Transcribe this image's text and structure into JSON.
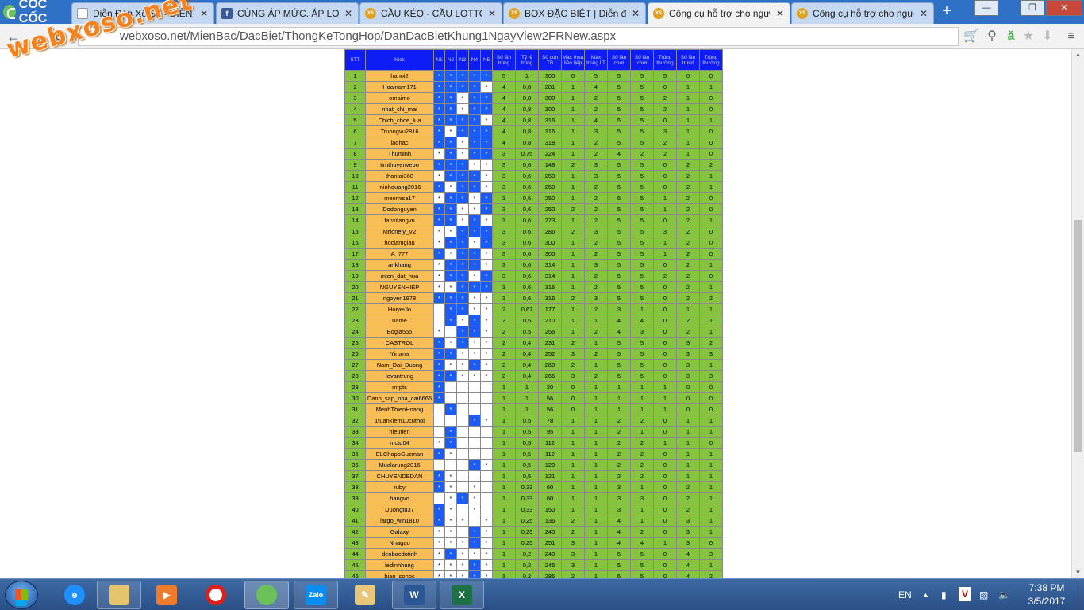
{
  "browser": {
    "logo_text": "CỐC CỐC",
    "tabs": [
      {
        "title": "Diễn Đàn Xổ Số - DIỄN ĐÀN",
        "favicon": "doc",
        "active": false
      },
      {
        "title": "CÙNG ÁP MỨC. ÁP LOẠI",
        "favicon": "fb",
        "active": false
      },
      {
        "title": "CẦU KÉO - CẦU LOTTO, I",
        "favicon": "xs",
        "active": false
      },
      {
        "title": "BOX ĐẶC BIỆT | Diễn đàn",
        "favicon": "xs",
        "active": false
      },
      {
        "title": "Công cụ hỗ trợ cho người",
        "favicon": "xs",
        "active": true
      },
      {
        "title": "Công cụ hỗ trợ cho người",
        "favicon": "xs",
        "active": false
      }
    ],
    "tab_favicon_xs": "XS",
    "tab_favicon_fb": "f",
    "address": "webxoso.net/MienBac/DacBiet/ThongKeTongHop/DanDacBietKhung1NgayView2FRNew.aspx",
    "watermark": "webxoso.net"
  },
  "table": {
    "headers": [
      "STT",
      "Nick",
      "N1",
      "N2",
      "N3",
      "N4",
      "N5",
      "Số lần trúng",
      "Tỷ lệ trúng",
      "Số con TB",
      "Max thua liên tiếp",
      "Max trúng LT",
      "Số lần chơi",
      "Số lần chơi",
      "Trúng thưởng",
      "Số lần trượt",
      "Trúng thưởng"
    ],
    "rows": [
      {
        "n": "hanoi2",
        "m": "bbbbb",
        "v": [
          "5",
          "1",
          "300",
          "0",
          "5",
          "5",
          "5",
          "5",
          "0",
          "0"
        ]
      },
      {
        "n": "Hoainam171",
        "m": "bbbbw",
        "v": [
          "4",
          "0,8",
          "281",
          "1",
          "4",
          "5",
          "5",
          "0",
          "1",
          "1"
        ]
      },
      {
        "n": "omaimo",
        "m": "bbwbb",
        "v": [
          "4",
          "0,8",
          "300",
          "1",
          "2",
          "5",
          "5",
          "2",
          "1",
          "0"
        ]
      },
      {
        "n": "nhat_chi_mai",
        "m": "bbwbb",
        "v": [
          "4",
          "0,8",
          "300",
          "1",
          "2",
          "5",
          "5",
          "2",
          "1",
          "0"
        ]
      },
      {
        "n": "Chich_choe_lua",
        "m": "bbbbw",
        "v": [
          "4",
          "0,8",
          "316",
          "1",
          "4",
          "5",
          "5",
          "0",
          "1",
          "1"
        ]
      },
      {
        "n": "Truongvu2816",
        "m": "bwbbb",
        "v": [
          "4",
          "0,8",
          "316",
          "1",
          "3",
          "5",
          "5",
          "3",
          "1",
          "0"
        ]
      },
      {
        "n": "laohac",
        "m": "bbwbb",
        "v": [
          "4",
          "0,8",
          "318",
          "1",
          "2",
          "5",
          "5",
          "2",
          "1",
          "0"
        ]
      },
      {
        "n": "Thuminh",
        "m": "wbwbb",
        "v": [
          "3",
          "0,75",
          "224",
          "1",
          "2",
          "4",
          "2",
          "2",
          "1",
          "0"
        ]
      },
      {
        "n": "timthuyenvebo",
        "m": "bbbww",
        "v": [
          "3",
          "0,6",
          "148",
          "2",
          "3",
          "5",
          "5",
          "0",
          "2",
          "2"
        ]
      },
      {
        "n": "thantai368",
        "m": "wbbbw",
        "v": [
          "3",
          "0,6",
          "250",
          "1",
          "3",
          "5",
          "5",
          "0",
          "2",
          "1"
        ]
      },
      {
        "n": "minhquang2016",
        "m": "bwbbw",
        "v": [
          "3",
          "0,6",
          "250",
          "1",
          "2",
          "5",
          "5",
          "0",
          "2",
          "1"
        ]
      },
      {
        "n": "meomisa17",
        "m": "wbbwb",
        "v": [
          "3",
          "0,6",
          "250",
          "1",
          "2",
          "5",
          "5",
          "1",
          "2",
          "0"
        ]
      },
      {
        "n": "Dodonguyen",
        "m": "bbwwb",
        "v": [
          "3",
          "0,6",
          "250",
          "2",
          "2",
          "5",
          "5",
          "1",
          "2",
          "0"
        ]
      },
      {
        "n": "fanxifangvn",
        "m": "bbwbw",
        "v": [
          "3",
          "0,6",
          "273",
          "1",
          "2",
          "5",
          "5",
          "0",
          "2",
          "1"
        ]
      },
      {
        "n": "Mrlonely_V2",
        "m": "wwbbb",
        "v": [
          "3",
          "0,6",
          "286",
          "2",
          "3",
          "5",
          "5",
          "3",
          "2",
          "0"
        ]
      },
      {
        "n": "hoclamgiau",
        "m": "wbbwb",
        "v": [
          "3",
          "0,6",
          "300",
          "1",
          "2",
          "5",
          "5",
          "1",
          "2",
          "0"
        ]
      },
      {
        "n": "A_777",
        "m": "bwbbw",
        "v": [
          "3",
          "0,6",
          "300",
          "1",
          "2",
          "5",
          "5",
          "1",
          "2",
          "0"
        ]
      },
      {
        "n": "ankhang",
        "m": "wbbbw",
        "v": [
          "3",
          "0,6",
          "314",
          "1",
          "3",
          "5",
          "5",
          "0",
          "2",
          "1"
        ]
      },
      {
        "n": "mien_dat_hua",
        "m": "wbbwb",
        "v": [
          "3",
          "0,6",
          "314",
          "1",
          "2",
          "5",
          "5",
          "2",
          "2",
          "0"
        ]
      },
      {
        "n": "NGUYENHIEP",
        "m": "wwbbb",
        "v": [
          "3",
          "0,6",
          "316",
          "1",
          "2",
          "5",
          "5",
          "0",
          "2",
          "1"
        ]
      },
      {
        "n": "ngoyen1978",
        "m": "bbbww",
        "v": [
          "3",
          "0,6",
          "316",
          "2",
          "3",
          "5",
          "5",
          "0",
          "2",
          "2"
        ]
      },
      {
        "n": "Hoiyeulo",
        "m": "ebbww",
        "v": [
          "2",
          "0,67",
          "177",
          "1",
          "2",
          "3",
          "1",
          "0",
          "1",
          "1"
        ]
      },
      {
        "n": "name",
        "m": "ebwbw",
        "v": [
          "2",
          "0,5",
          "210",
          "1",
          "1",
          "4",
          "4",
          "0",
          "2",
          "1"
        ]
      },
      {
        "n": "Bogia555",
        "m": "webbw",
        "v": [
          "2",
          "0,5",
          "256",
          "1",
          "2",
          "4",
          "3",
          "0",
          "2",
          "1"
        ]
      },
      {
        "n": "CASTROL",
        "m": "bwbww",
        "v": [
          "2",
          "0,4",
          "231",
          "2",
          "1",
          "5",
          "5",
          "0",
          "3",
          "2"
        ]
      },
      {
        "n": "Yiruma",
        "m": "bbwww",
        "v": [
          "2",
          "0,4",
          "252",
          "3",
          "2",
          "5",
          "5",
          "0",
          "3",
          "3"
        ]
      },
      {
        "n": "Nam_Dai_Duong",
        "m": "bwwbw",
        "v": [
          "2",
          "0,4",
          "260",
          "2",
          "1",
          "5",
          "5",
          "0",
          "3",
          "1"
        ]
      },
      {
        "n": "levantrung",
        "m": "bbwww",
        "v": [
          "2",
          "0,4",
          "266",
          "3",
          "2",
          "5",
          "5",
          "0",
          "3",
          "3"
        ]
      },
      {
        "n": "mrpts",
        "m": "beeee",
        "v": [
          "1",
          "1",
          "20",
          "0",
          "1",
          "1",
          "1",
          "1",
          "0",
          "0"
        ]
      },
      {
        "n": "Danh_sap_nha_cai6666",
        "m": "beeee",
        "v": [
          "1",
          "1",
          "56",
          "0",
          "1",
          "1",
          "1",
          "1",
          "0",
          "0"
        ]
      },
      {
        "n": "MenhThienHoang",
        "m": "ebeee",
        "v": [
          "1",
          "1",
          "56",
          "0",
          "1",
          "1",
          "1",
          "1",
          "0",
          "0"
        ]
      },
      {
        "n": "1tuankiem10cuthoi",
        "m": "eeebw",
        "v": [
          "1",
          "0,5",
          "78",
          "1",
          "1",
          "2",
          "2",
          "0",
          "1",
          "1"
        ]
      },
      {
        "n": "hieutien",
        "m": "ebeee",
        "v": [
          "1",
          "0,5",
          "95",
          "1",
          "1",
          "2",
          "1",
          "0",
          "1",
          "1"
        ]
      },
      {
        "n": "mctq04",
        "m": "wbeee",
        "v": [
          "1",
          "0,5",
          "112",
          "1",
          "1",
          "2",
          "2",
          "1",
          "1",
          "0"
        ]
      },
      {
        "n": "ELChapoGuzman",
        "m": "bweee",
        "v": [
          "1",
          "0,5",
          "112",
          "1",
          "1",
          "2",
          "2",
          "0",
          "1",
          "1"
        ]
      },
      {
        "n": "Mualarung2016",
        "m": "eeebw",
        "v": [
          "1",
          "0,5",
          "120",
          "1",
          "1",
          "2",
          "2",
          "0",
          "1",
          "1"
        ]
      },
      {
        "n": "CHUYENDEDAN",
        "m": "bweee",
        "v": [
          "1",
          "0,5",
          "121",
          "1",
          "1",
          "2",
          "2",
          "0",
          "1",
          "1"
        ]
      },
      {
        "n": "ruby",
        "m": "bwewe",
        "v": [
          "1",
          "0,33",
          "60",
          "1",
          "1",
          "3",
          "1",
          "0",
          "2",
          "1"
        ]
      },
      {
        "n": "hangvo",
        "m": "ewbwe",
        "v": [
          "1",
          "0,33",
          "60",
          "1",
          "1",
          "3",
          "3",
          "0",
          "2",
          "1"
        ]
      },
      {
        "n": "Duongtu37",
        "m": "bwewe",
        "v": [
          "1",
          "0,33",
          "150",
          "1",
          "1",
          "3",
          "1",
          "0",
          "2",
          "1"
        ]
      },
      {
        "n": "largo_win1810",
        "m": "bwwew",
        "v": [
          "1",
          "0,25",
          "136",
          "2",
          "1",
          "4",
          "1",
          "0",
          "3",
          "1"
        ]
      },
      {
        "n": "Galaxy",
        "m": "wwebw",
        "v": [
          "1",
          "0,25",
          "240",
          "2",
          "1",
          "4",
          "2",
          "0",
          "3",
          "1"
        ]
      },
      {
        "n": "Nhagao",
        "m": "wwwbw",
        "v": [
          "1",
          "0,25",
          "251",
          "3",
          "1",
          "4",
          "4",
          "1",
          "3",
          "0"
        ]
      },
      {
        "n": "denbacdotinh",
        "m": "wbwww",
        "v": [
          "1",
          "0,2",
          "240",
          "3",
          "1",
          "5",
          "5",
          "0",
          "4",
          "3"
        ]
      },
      {
        "n": "ledinhhung",
        "m": "wwwbw",
        "v": [
          "1",
          "0,2",
          "245",
          "3",
          "1",
          "5",
          "5",
          "0",
          "4",
          "1"
        ]
      },
      {
        "n": "bian_sohoc",
        "m": "wwwbw",
        "v": [
          "1",
          "0,2",
          "286",
          "2",
          "1",
          "5",
          "5",
          "0",
          "4",
          "2"
        ]
      }
    ]
  },
  "taskbar": {
    "apps": [
      "explorer",
      "ie",
      "media",
      "opera",
      "coccoc",
      "zalo",
      "paint",
      "word",
      "excel"
    ],
    "zalo_label": "Zalo",
    "word_label": "W",
    "excel_label": "X",
    "lang": "EN",
    "time": "7:38 PM",
    "date": "3/5/2017"
  }
}
